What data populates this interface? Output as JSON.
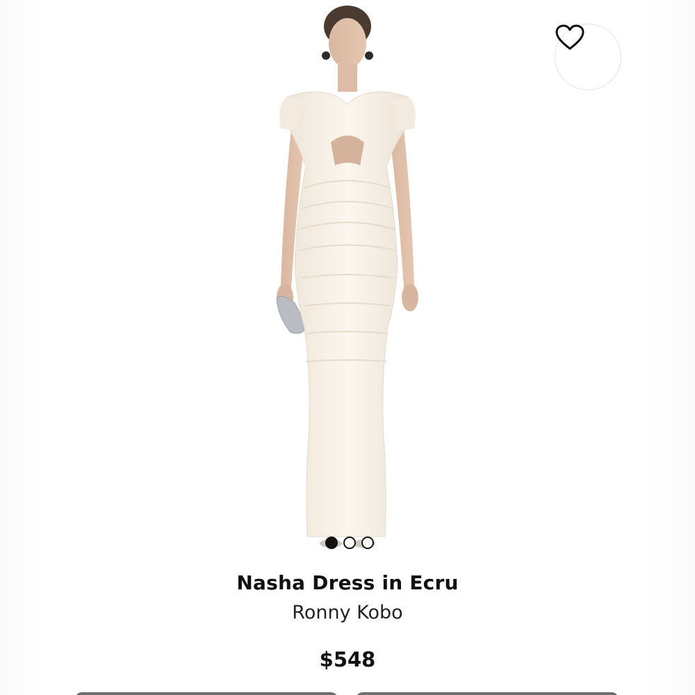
{
  "product": {
    "title": "Nasha Dress in Ecru",
    "brand": "Ronny Kobo",
    "price": "$548"
  },
  "carousel": {
    "image_count": 3,
    "active_index": 0
  },
  "icons": {
    "wishlist": "heart-outline-icon"
  },
  "colors": {
    "text": "#111111",
    "dress": "#f6efe4",
    "dot_active": "#111111"
  }
}
